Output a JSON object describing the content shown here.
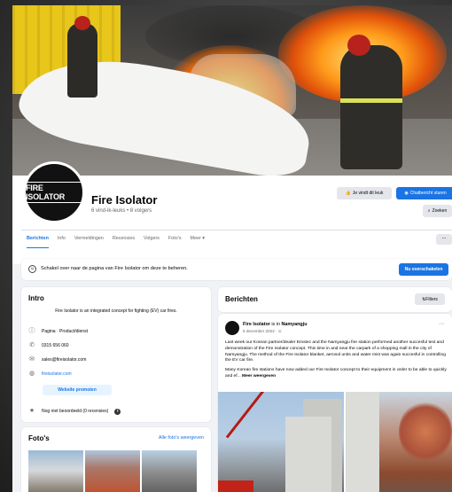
{
  "page": {
    "name": "Fire Isolator",
    "stats": "6 vind-ik-leuks • 8 volgers",
    "logo_text": "FIRE ISOLATOR"
  },
  "actions": {
    "like": "Je vindt dit leuk",
    "chat": "Chatbericht sturen",
    "search": "Zoeken",
    "more": "..."
  },
  "tabs": [
    {
      "label": "Berichten",
      "active": true
    },
    {
      "label": "Info"
    },
    {
      "label": "Vermeldingen"
    },
    {
      "label": "Recensies"
    },
    {
      "label": "Volgers"
    },
    {
      "label": "Foto's"
    },
    {
      "label": "Meer ▾"
    }
  ],
  "switch_banner": {
    "text": "Schakel over naar de pagina van Fire Isolator om deze te beheren.",
    "button": "Nu overschakelen"
  },
  "intro": {
    "title": "Intro",
    "description": "Fire Isolator is an integrated concept for fighting (EV) car fires.",
    "category": "Pagina · Product/dienst",
    "phone": "0315 656 060",
    "email": "sales@fireisolator.com",
    "website": "fireisolator.com",
    "promote": "Website promoten",
    "rating": "Nog niet beoordeeld (0 recensies)"
  },
  "photos": {
    "title": "Foto's",
    "all_link": "Alle foto's weergeven"
  },
  "posts": {
    "title": "Berichten",
    "filters": "Filters",
    "post": {
      "author": "Fire Isolator",
      "location_prefix": "is in",
      "location": "Namyangju",
      "date": "5 december 2022 · ⊙",
      "paragraph1": "Last week our Korean partner/dealer Emstec and the Namyangju fire station performed another succesful test and demonstration of the Fire Isolator concept. This time in and near the carpark of a shopping mall in the city of Namyangju. The method of the Fire Isolator blanket, aerosol units and water mist was again succesful in controlling the EV car fire.",
      "paragraph2": "Many Korean fire stations have now added our Fire Isolator concept to their equipment in order to be able to quickly and ef...",
      "more": "Meer weergeven"
    }
  }
}
